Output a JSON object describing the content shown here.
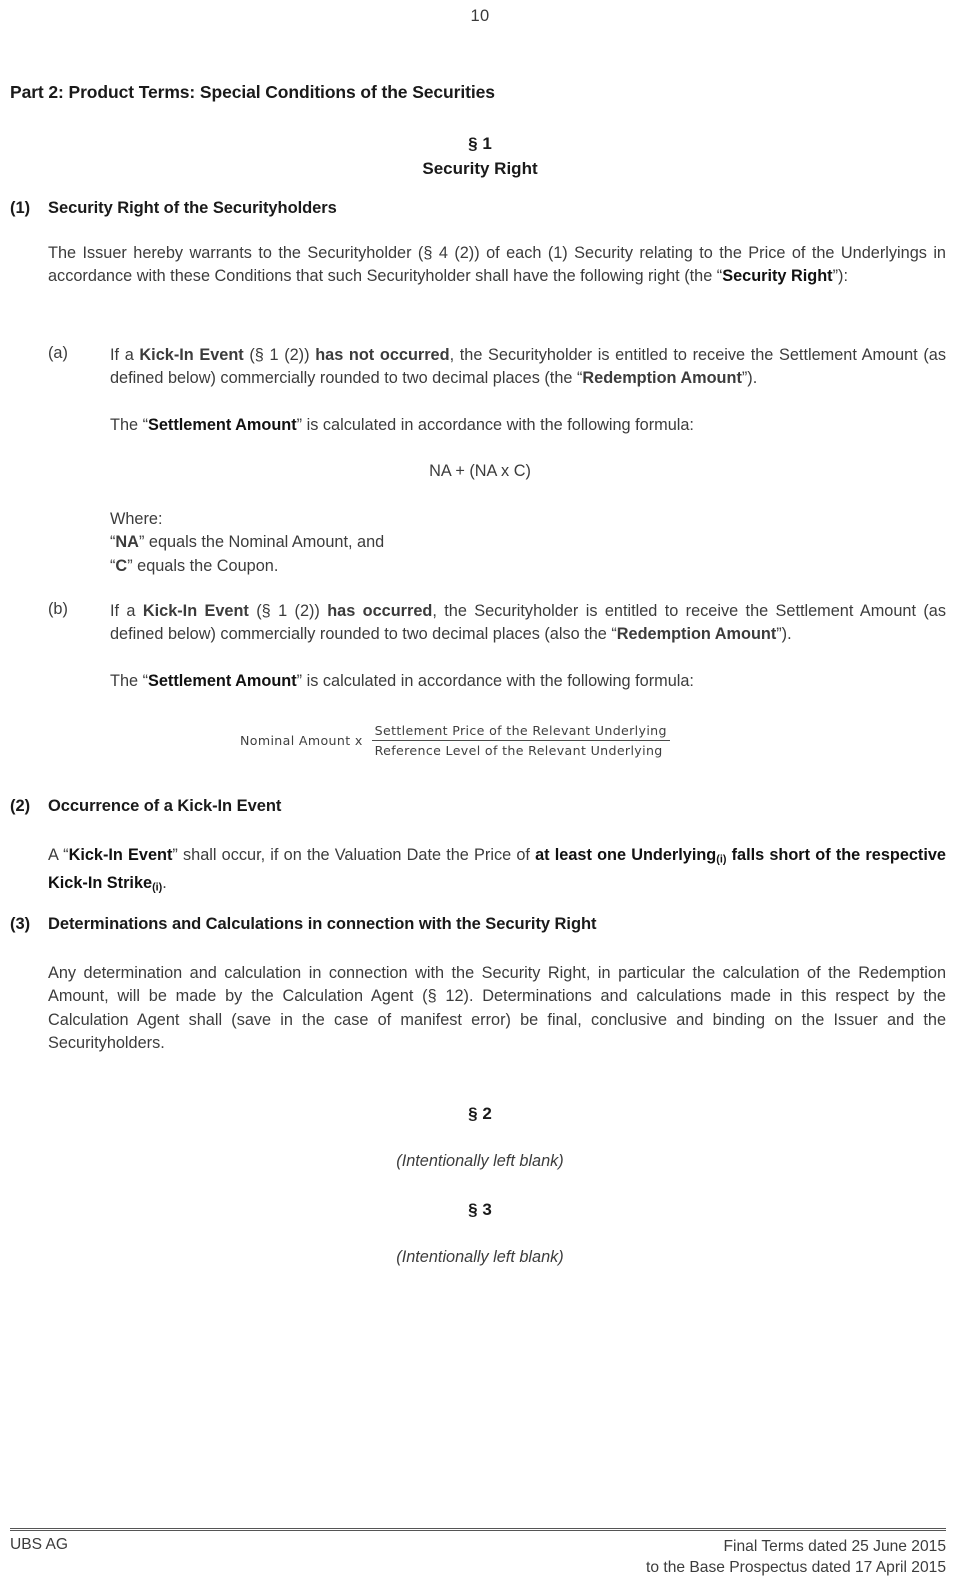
{
  "page": {
    "number": "10"
  },
  "part_heading": "Part 2: Product Terms: Special Conditions of the Securities",
  "sections": {
    "sec1": {
      "symbol": "§ 1",
      "title": "Security Right"
    },
    "sec2": {
      "symbol": "§ 2",
      "body": "(Intentionally left blank)"
    },
    "sec3": {
      "symbol": "§ 3",
      "body": "(Intentionally left blank)"
    }
  },
  "clauses": [
    {
      "number": "(1)",
      "title": "Security Right of the Securityholders",
      "intro_html": "The Issuer hereby warrants to the Securityholder (§ 4 (2)) of each (1) Security relating to the Price of the Underlyings in accordance with these Conditions that such Securityholder shall have the following right (the “<b>Security Right</b>”):",
      "subitems": [
        {
          "letter": "(a)",
          "body_html": "If a <b>Kick-In Event</b> (§ 1 (2)) <b>has not occurred</b>, the Securityholder is entitled to receive the Settlement Amount (as defined below) commercially rounded to two decimal places (the “<b>Redemption Amount</b>”).",
          "formula_lead_html": "The “<b>Settlement Amount</b>” is calculated in accordance with the following formula:",
          "formula": {
            "type": "inline",
            "expression": "NA + (NA x C)"
          },
          "where": {
            "label": "Where:",
            "lines_html": [
              "“<b>NA</b>” equals the Nominal Amount, and",
              "“<b>C</b>” equals the Coupon."
            ]
          }
        },
        {
          "letter": "(b)",
          "body_html": "If a <b>Kick-In Event</b> (§ 1 (2)) <b>has occurred</b>, the Securityholder is entitled to receive the Settlement Amount (as defined below) commercially rounded to two decimal places (also the “<b>Redemption Amount</b>”).",
          "formula_lead_html": "The “<b>Settlement Amount</b>” is calculated in accordance with the following formula:",
          "formula": {
            "type": "fraction",
            "left": "Nominal Amount  x",
            "numerator": "Settlement Price of the Relevant Underlying",
            "denominator": "Reference Level of the Relevant Underlying"
          }
        }
      ]
    },
    {
      "number": "(2)",
      "title": "Occurrence of a Kick-In Event",
      "body_html": "A “<b>Kick-In Event</b>” shall occur, if on the Valuation Date the Price of <b>at least one Underlying<sub>(i)</sub> falls short of the respective Kick-In Strike<sub>(i)</sub></b>."
    },
    {
      "number": "(3)",
      "title": "Determinations and Calculations in connection with the Security Right",
      "body_html": "Any determination and calculation in connection with the Security Right, in particular the calculation of the Redemption Amount, will be made by the Calculation Agent (§ 12). Determinations and calculations made in this respect by the Calculation Agent shall (save in the case of manifest error) be final, conclusive and binding on the Issuer and the Securityholders."
    }
  ],
  "footer": {
    "left": "UBS AG",
    "right_line1": "Final Terms dated 25 June 2015",
    "right_line2": "to the Base Prospectus dated 17 April 2015"
  }
}
